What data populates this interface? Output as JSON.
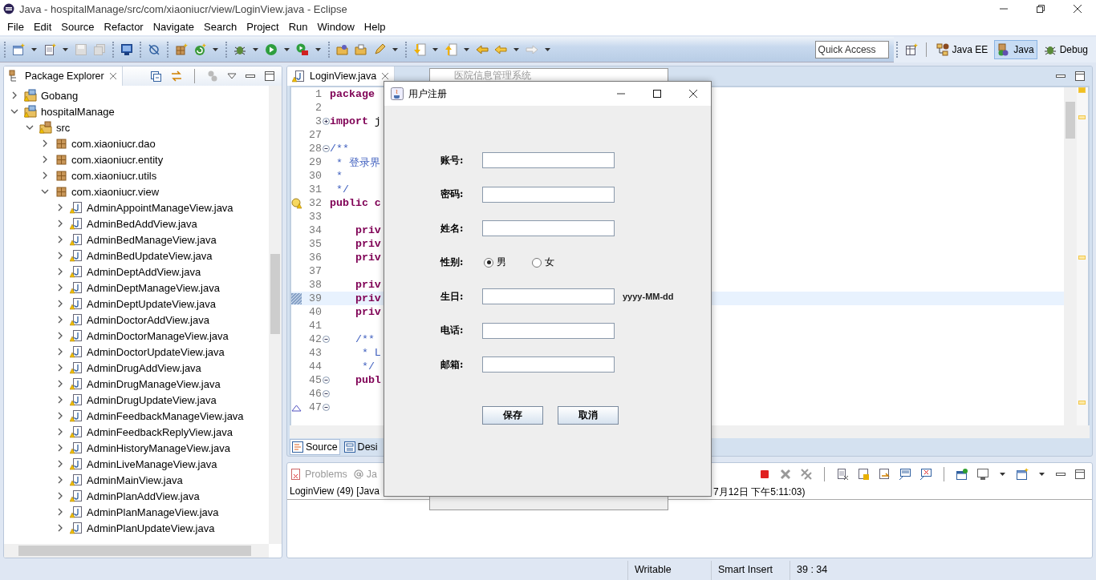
{
  "window": {
    "title": "Java - hospitalManage/src/com/xiaoniucr/view/LoginView.java - Eclipse"
  },
  "menu": [
    {
      "label": "File"
    },
    {
      "label": "Edit"
    },
    {
      "label": "Source"
    },
    {
      "label": "Refactor"
    },
    {
      "label": "Navigate"
    },
    {
      "label": "Search"
    },
    {
      "label": "Project"
    },
    {
      "label": "Run"
    },
    {
      "label": "Window"
    },
    {
      "label": "Help"
    }
  ],
  "quick_access": {
    "placeholder": "Quick Access"
  },
  "perspectives": [
    {
      "label": "Java EE",
      "selected": false
    },
    {
      "label": "Java",
      "selected": true
    },
    {
      "label": "Debug",
      "selected": false
    }
  ],
  "package_explorer": {
    "title": "Package Explorer",
    "tree": [
      {
        "label": "Gobang",
        "kind": "project",
        "expanded": false
      },
      {
        "label": "hospitalManage",
        "kind": "project",
        "expanded": true,
        "children": [
          {
            "label": "src",
            "kind": "source-folder",
            "expanded": true,
            "children": [
              {
                "label": "com.xiaoniucr.dao",
                "kind": "package",
                "expanded": false
              },
              {
                "label": "com.xiaoniucr.entity",
                "kind": "package",
                "expanded": false
              },
              {
                "label": "com.xiaoniucr.utils",
                "kind": "package",
                "expanded": false
              },
              {
                "label": "com.xiaoniucr.view",
                "kind": "package",
                "expanded": true,
                "children": [
                  {
                    "label": "AdminAppointManageView.java",
                    "kind": "file",
                    "expanded": false
                  },
                  {
                    "label": "AdminBedAddView.java",
                    "kind": "file",
                    "expanded": false
                  },
                  {
                    "label": "AdminBedManageView.java",
                    "kind": "file",
                    "expanded": false
                  },
                  {
                    "label": "AdminBedUpdateView.java",
                    "kind": "file",
                    "expanded": false
                  },
                  {
                    "label": "AdminDeptAddView.java",
                    "kind": "file",
                    "expanded": false
                  },
                  {
                    "label": "AdminDeptManageView.java",
                    "kind": "file",
                    "expanded": false
                  },
                  {
                    "label": "AdminDeptUpdateView.java",
                    "kind": "file",
                    "expanded": false
                  },
                  {
                    "label": "AdminDoctorAddView.java",
                    "kind": "file",
                    "expanded": false
                  },
                  {
                    "label": "AdminDoctorManageView.java",
                    "kind": "file",
                    "expanded": false
                  },
                  {
                    "label": "AdminDoctorUpdateView.java",
                    "kind": "file",
                    "expanded": false
                  },
                  {
                    "label": "AdminDrugAddView.java",
                    "kind": "file",
                    "expanded": false
                  },
                  {
                    "label": "AdminDrugManageView.java",
                    "kind": "file",
                    "expanded": false
                  },
                  {
                    "label": "AdminDrugUpdateView.java",
                    "kind": "file",
                    "expanded": false
                  },
                  {
                    "label": "AdminFeedbackManageView.java",
                    "kind": "file",
                    "expanded": false
                  },
                  {
                    "label": "AdminFeedbackReplyView.java",
                    "kind": "file",
                    "expanded": false
                  },
                  {
                    "label": "AdminHistoryManageView.java",
                    "kind": "file",
                    "expanded": false
                  },
                  {
                    "label": "AdminLiveManageView.java",
                    "kind": "file",
                    "expanded": false
                  },
                  {
                    "label": "AdminMainView.java",
                    "kind": "file",
                    "expanded": false
                  },
                  {
                    "label": "AdminPlanAddView.java",
                    "kind": "file",
                    "expanded": false
                  },
                  {
                    "label": "AdminPlanManageView.java",
                    "kind": "file",
                    "expanded": false
                  },
                  {
                    "label": "AdminPlanUpdateView.java",
                    "kind": "file",
                    "expanded": false
                  }
                ]
              }
            ]
          }
        ]
      }
    ]
  },
  "editor": {
    "tab": "LoginView.java",
    "lines": [
      {
        "number": "1",
        "parts": [
          {
            "text": "package",
            "kind": "keyword"
          }
        ]
      },
      {
        "number": "2"
      },
      {
        "number": "3",
        "fold_expanded": false,
        "parts": [
          {
            "text": "import",
            "kind": "keyword"
          },
          {
            "text": " j",
            "kind": "plain"
          }
        ]
      },
      {
        "number": "27"
      },
      {
        "number": "28",
        "fold_expanded": true,
        "parts": [
          {
            "text": "/**",
            "kind": "comment"
          }
        ]
      },
      {
        "number": "29",
        "parts": [
          {
            "text": " * 登录界",
            "kind": "comment"
          }
        ]
      },
      {
        "number": "30",
        "parts": [
          {
            "text": " *",
            "kind": "comment"
          }
        ]
      },
      {
        "number": "31",
        "parts": [
          {
            "text": " */",
            "kind": "comment"
          }
        ]
      },
      {
        "number": "32",
        "warning": true,
        "parts": [
          {
            "text": "public c",
            "kind": "keyword"
          }
        ]
      },
      {
        "number": "33"
      },
      {
        "number": "34",
        "parts": [
          {
            "text": "    priv",
            "kind": "keyword"
          }
        ]
      },
      {
        "number": "35",
        "parts": [
          {
            "text": "    priv",
            "kind": "keyword"
          }
        ]
      },
      {
        "number": "36",
        "parts": [
          {
            "text": "    priv",
            "kind": "keyword"
          }
        ]
      },
      {
        "number": "37"
      },
      {
        "number": "38",
        "parts": [
          {
            "text": "    priv",
            "kind": "keyword"
          }
        ]
      },
      {
        "number": "39",
        "current": true,
        "parts": [
          {
            "text": "    priv",
            "kind": "keyword"
          }
        ]
      },
      {
        "number": "40",
        "parts": [
          {
            "text": "    priv",
            "kind": "keyword"
          }
        ]
      },
      {
        "number": "41"
      },
      {
        "number": "42",
        "fold_expanded": true,
        "parts": [
          {
            "text": "    /**",
            "kind": "comment"
          }
        ]
      },
      {
        "number": "43",
        "parts": [
          {
            "text": "     * L",
            "kind": "comment"
          }
        ]
      },
      {
        "number": "44",
        "parts": [
          {
            "text": "     */",
            "kind": "comment"
          }
        ]
      },
      {
        "number": "45",
        "fold_expanded": true,
        "parts": [
          {
            "text": "    publ",
            "kind": "keyword"
          }
        ]
      },
      {
        "number": "46",
        "fold_expanded": true
      },
      {
        "number": "47",
        "fold_expanded": true,
        "change": true
      }
    ],
    "bottom_tabs": [
      {
        "label": "Source",
        "selected": true
      },
      {
        "label": "Desi",
        "selected": false
      }
    ]
  },
  "console": {
    "tabs": [
      {
        "label": "Problems"
      },
      {
        "label": "Ja"
      }
    ],
    "line_start": "LoginView (49) [Java",
    "line_end": "7月12日 下午5:11:03)"
  },
  "background_window": {
    "title": "医院信息管理系统"
  },
  "dialog": {
    "title": "用户注册",
    "fields": [
      {
        "kind": "text",
        "label": "账号:"
      },
      {
        "kind": "text",
        "label": "密码:"
      },
      {
        "kind": "text",
        "label": "姓名:"
      },
      {
        "kind": "radio",
        "label": "性别:",
        "options": [
          {
            "label": "男",
            "selected": true
          },
          {
            "label": "女",
            "selected": false
          }
        ]
      },
      {
        "kind": "text",
        "label": "生日:",
        "hint": "yyyy-MM-dd"
      },
      {
        "kind": "text",
        "label": "电话:"
      },
      {
        "kind": "text",
        "label": "邮箱:"
      }
    ],
    "buttons": [
      {
        "label": "保存"
      },
      {
        "label": "取消"
      }
    ]
  },
  "status_bar": [
    {
      "label": "Writable"
    },
    {
      "label": "Smart Insert"
    },
    {
      "label": "39 : 34"
    }
  ]
}
